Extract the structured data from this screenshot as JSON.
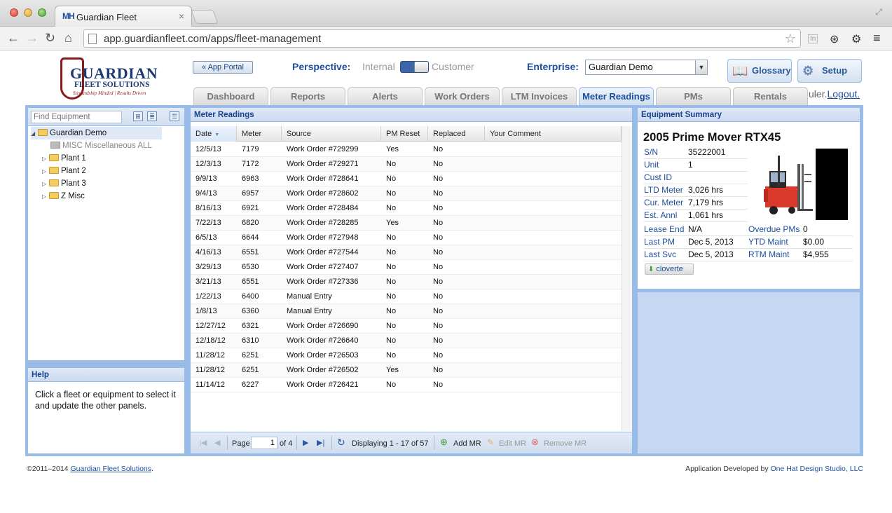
{
  "browser": {
    "tab_favicon": "MH",
    "tab_title": "Guardian Fleet",
    "tab_close": "×",
    "url": "app.guardianfleet.com/apps/fleet-management",
    "back_icon": "←",
    "forward_icon": "→",
    "reload_icon": "↻",
    "home_icon": "⌂",
    "star_icon": "☆",
    "menu_icon": "≡",
    "settings_icon": "⚙",
    "ext_icon": "In",
    "sync_icon": "⊛",
    "fullscreen_icon": "⤢"
  },
  "header": {
    "logo_main": "GUARDIAN",
    "logo_sub": "FLEET SOLUTIONS",
    "logo_tagline": "Stewardship Minded | Results Driven",
    "app_portal": "« App Portal",
    "perspective_label": "Perspective:",
    "perspective_internal": "Internal",
    "perspective_customer": "Customer",
    "enterprise_label": "Enterprise:",
    "enterprise_value": "Guardian Demo",
    "glossary": "Glossary",
    "setup": "Setup",
    "user_fragment": "uler.",
    "logout": "Logout."
  },
  "tabs": [
    "Dashboard",
    "Reports",
    "Alerts",
    "Work Orders",
    "LTM Invoices",
    "Meter Readings",
    "PMs",
    "Rentals"
  ],
  "active_tab": "Meter Readings",
  "tree": {
    "search_placeholder": "Find Equipment",
    "items": [
      {
        "label": "Guardian Demo",
        "expander": "◢"
      },
      {
        "label": "MISC Miscellaneous ALL"
      },
      {
        "label": "Plant 1",
        "expander": "▷"
      },
      {
        "label": "Plant 2",
        "expander": "▷"
      },
      {
        "label": "Plant 3",
        "expander": "▷"
      },
      {
        "label": "Z Misc",
        "expander": "▷"
      }
    ]
  },
  "help": {
    "title": "Help",
    "text": "Click a fleet or equipment to select it and update the other panels."
  },
  "grid": {
    "title": "Meter Readings",
    "columns": [
      "Date",
      "Meter",
      "Source",
      "PM Reset",
      "Replaced",
      "Your Comment"
    ],
    "sort_icon": "▼",
    "rows": [
      [
        "12/5/13",
        "7179",
        "Work Order #729299",
        "Yes",
        "No",
        ""
      ],
      [
        "12/3/13",
        "7172",
        "Work Order #729271",
        "No",
        "No",
        ""
      ],
      [
        "9/9/13",
        "6963",
        "Work Order #728641",
        "No",
        "No",
        ""
      ],
      [
        "9/4/13",
        "6957",
        "Work Order #728602",
        "No",
        "No",
        ""
      ],
      [
        "8/16/13",
        "6921",
        "Work Order #728484",
        "No",
        "No",
        ""
      ],
      [
        "7/22/13",
        "6820",
        "Work Order #728285",
        "Yes",
        "No",
        ""
      ],
      [
        "6/5/13",
        "6644",
        "Work Order #727948",
        "No",
        "No",
        ""
      ],
      [
        "4/16/13",
        "6551",
        "Work Order #727544",
        "No",
        "No",
        ""
      ],
      [
        "3/29/13",
        "6530",
        "Work Order #727407",
        "No",
        "No",
        ""
      ],
      [
        "3/21/13",
        "6551",
        "Work Order #727336",
        "No",
        "No",
        ""
      ],
      [
        "1/22/13",
        "6400",
        "Manual Entry",
        "No",
        "No",
        ""
      ],
      [
        "1/8/13",
        "6360",
        "Manual Entry",
        "No",
        "No",
        ""
      ],
      [
        "12/27/12",
        "6321",
        "Work Order #726690",
        "No",
        "No",
        ""
      ],
      [
        "12/18/12",
        "6310",
        "Work Order #726640",
        "No",
        "No",
        ""
      ],
      [
        "11/28/12",
        "6251",
        "Work Order #726503",
        "No",
        "No",
        ""
      ],
      [
        "11/28/12",
        "6251",
        "Work Order #726502",
        "Yes",
        "No",
        ""
      ],
      [
        "11/14/12",
        "6227",
        "Work Order #726421",
        "No",
        "No",
        ""
      ]
    ],
    "pager": {
      "first_icon": "|◀",
      "prev_icon": "◀",
      "page_label": "Page",
      "page_value": "1",
      "of_label": "of 4",
      "next_icon": "▶",
      "last_icon": "▶|",
      "refresh_icon": "↻",
      "displaying": "Displaying 1 - 17 of 57",
      "add": "Add MR",
      "edit": "Edit MR",
      "remove": "Remove MR",
      "add_icon": "⊕",
      "edit_icon": "✎",
      "remove_icon": "⊗"
    }
  },
  "equipment": {
    "panel_title": "Equipment Summary",
    "title": "2005 Prime Mover RTX45",
    "fields": [
      {
        "key": "S/N",
        "value": "35222001"
      },
      {
        "key": "Unit",
        "value": "1"
      },
      {
        "key": "Cust ID",
        "value": ""
      },
      {
        "key": "LTD Meter",
        "value": "3,026 hrs"
      },
      {
        "key": "Cur. Meter",
        "value": "7,179 hrs"
      },
      {
        "key": "Est. Annl",
        "value": "1,061 hrs"
      }
    ],
    "fields_wide": [
      {
        "key": "Lease End",
        "value": "N/A",
        "key2": "Overdue PMs",
        "value2": "0"
      },
      {
        "key": "Last PM",
        "value": "Dec 5, 2013",
        "key2": "YTD Maint",
        "value2": "$0.00"
      },
      {
        "key": "Last Svc",
        "value": "Dec 5, 2013",
        "key2": "RTM Maint",
        "value2": "$4,955"
      }
    ],
    "button": "cloverte",
    "button_icon": "⬇"
  },
  "footer": {
    "copyright": "©2011–2014 ",
    "company_link": "Guardian Fleet Solutions",
    "period": ".",
    "developed_by": "Application Developed by ",
    "developer_link": "One Hat Design Studio, LLC"
  }
}
